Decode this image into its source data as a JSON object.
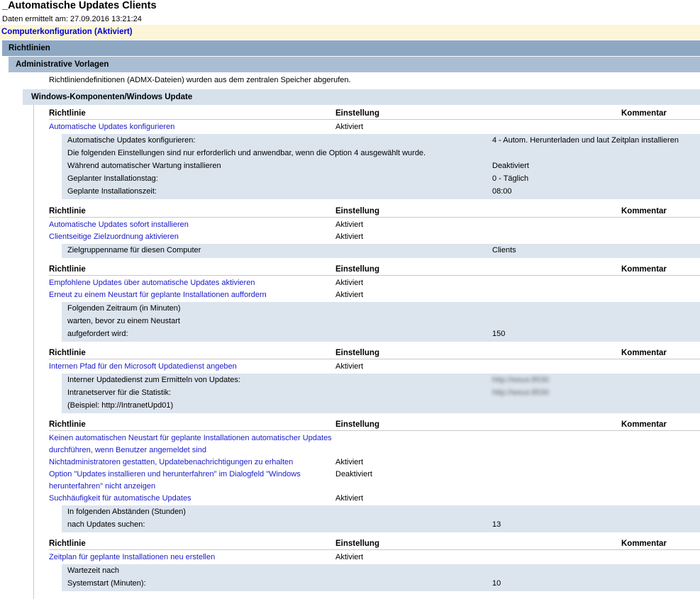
{
  "title": "_Automatische Updates Clients",
  "subtitle": "Daten ermittelt am: 27.09.2016 13:21:24",
  "section": "Computerkonfiguration (Aktiviert)",
  "level1": "Richtlinien",
  "level2": "Administrative Vorlagen",
  "note": "Richtliniendefinitionen (ADMX-Dateien) wurden aus dem zentralen Speicher abgerufen.",
  "level3": "Windows-Komponenten/Windows Update",
  "headers": {
    "policy": "Richtlinie",
    "setting": "Einstellung",
    "comment": "Kommentar"
  },
  "groups": [
    {
      "policies": [
        {
          "name": [
            "Automatische Updates konfigurieren"
          ],
          "value": "Aktiviert"
        }
      ],
      "details": [
        {
          "label": "Automatische Updates konfigurieren:",
          "value": "4 - Autom. Herunterladen und laut Zeitplan installieren"
        },
        {
          "label": "Die folgenden Einstellungen sind nur erforderlich und anwendbar, wenn die Option 4 ausgewählt wurde.",
          "value": ""
        },
        {
          "label": "Während automatischer Wartung installieren",
          "value": "Deaktiviert"
        },
        {
          "label": "Geplanter Installationstag:",
          "value": "0 - Täglich"
        },
        {
          "label": "Geplante Installationszeit:",
          "value": "08:00"
        }
      ]
    },
    {
      "policies": [
        {
          "name": [
            "Automatische Updates sofort installieren"
          ],
          "value": "Aktiviert"
        },
        {
          "name": [
            "Clientseitige Zielzuordnung aktivieren"
          ],
          "value": "Aktiviert"
        }
      ],
      "details": [
        {
          "label": "Zielgruppenname für diesen Computer",
          "value": "Clients"
        }
      ]
    },
    {
      "policies": [
        {
          "name": [
            "Empfohlene Updates über automatische Updates aktivieren"
          ],
          "value": "Aktiviert"
        },
        {
          "name": [
            "Erneut zu einem Neustart für geplante Installationen auffordern"
          ],
          "value": "Aktiviert"
        }
      ],
      "details": [
        {
          "label": "Folgenden Zeitraum (in Minuten)",
          "value": ""
        },
        {
          "label": "warten, bevor zu einem Neustart",
          "value": ""
        },
        {
          "label": "aufgefordert wird:",
          "value": "150"
        }
      ]
    },
    {
      "policies": [
        {
          "name": [
            "Internen Pfad für den Microsoft Updatedienst angeben"
          ],
          "value": "Aktiviert"
        }
      ],
      "details": [
        {
          "label": "Interner Updatedienst zum Ermitteln von Updates:",
          "value": "http://wsus:8530",
          "blur": true
        },
        {
          "label": "Intranetserver für die Statistik:",
          "value": "http://wsus:8530",
          "blur": true
        },
        {
          "label": "(Beispiel: http://IntranetUpd01)",
          "value": ""
        }
      ]
    },
    {
      "policies": [
        {
          "name": [
            "Keinen automatischen Neustart für geplante Installationen automatischer Updates",
            "durchführen, wenn Benutzer angemeldet sind"
          ],
          "value": ""
        },
        {
          "name": [
            "Nichtadministratoren gestatten, Updatebenachrichtigungen zu erhalten"
          ],
          "value": "Aktiviert"
        },
        {
          "name": [
            "Option \"Updates installieren und herunterfahren\" im Dialogfeld \"Windows",
            "herunterfahren\" nicht anzeigen"
          ],
          "value": "Deaktiviert"
        },
        {
          "name": [
            "Suchhäufigkeit für automatische Updates"
          ],
          "value": "Aktiviert"
        }
      ],
      "details": [
        {
          "label": "In folgenden Abständen (Stunden)",
          "value": ""
        },
        {
          "label": "nach Updates suchen:",
          "value": "13"
        }
      ]
    },
    {
      "policies": [
        {
          "name": [
            "Zeitplan für geplante Installationen neu erstellen"
          ],
          "value": "Aktiviert"
        }
      ],
      "details": [
        {
          "label": "Wartezeit nach",
          "value": ""
        },
        {
          "label": "Systemstart (Minuten):",
          "value": "10"
        }
      ]
    }
  ]
}
